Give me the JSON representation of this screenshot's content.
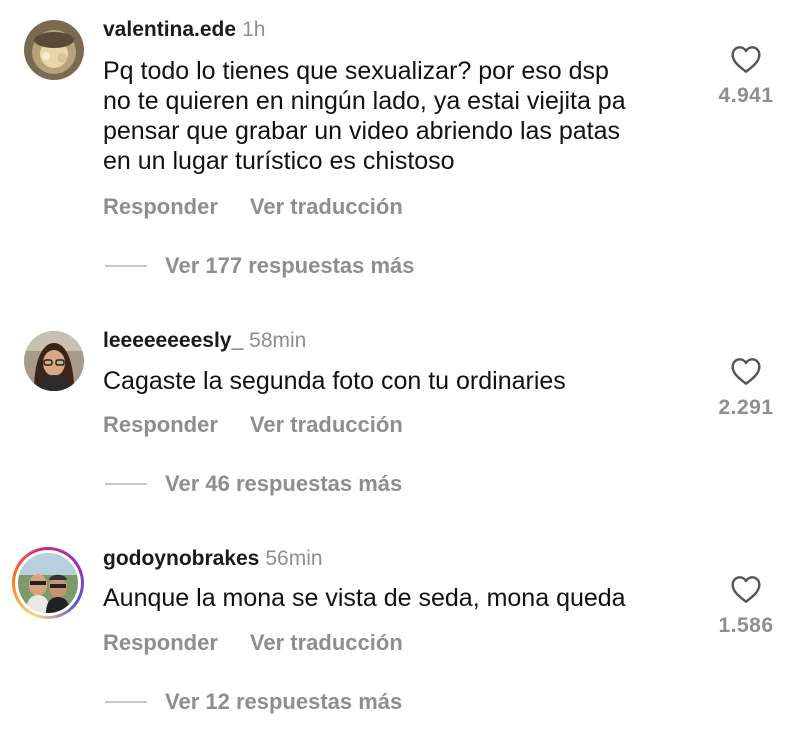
{
  "comments": [
    {
      "username": "valentina.ede",
      "time": "1h",
      "lines": [
        "Pq todo lo tienes que sexualizar? por eso dsp",
        "no te quieren en ningún lado, ya estai viejita pa",
        "pensar que grabar un video abriendo las patas",
        "en un lugar turístico es chistoso"
      ],
      "reply_label": "Responder",
      "translate_label": "Ver traducción",
      "more_replies": "Ver 177 respuestas más",
      "likes": "4.941",
      "icon": "heart-outline-icon"
    },
    {
      "username": "leeeeeeeesly_",
      "time": "58min",
      "lines": [
        "Cagaste la segunda foto con tu ordinaries"
      ],
      "reply_label": "Responder",
      "translate_label": "Ver traducción",
      "more_replies": "Ver 46 respuestas más",
      "likes": "2.291",
      "icon": "heart-outline-icon"
    },
    {
      "username": "godoynobrakes",
      "time": "56min",
      "lines": [
        "Aunque la mona se vista de seda, mona queda"
      ],
      "reply_label": "Responder",
      "translate_label": "Ver traducción",
      "more_replies": "Ver 12 respuestas más",
      "likes": "1.586",
      "icon": "heart-outline-icon"
    }
  ],
  "colors": {
    "secondary_text": "#8e8e8e",
    "primary_text": "#111111",
    "story_ring": [
      "#feda75",
      "#fa7e1e",
      "#d62976",
      "#962fbf",
      "#4f5bd5"
    ]
  }
}
